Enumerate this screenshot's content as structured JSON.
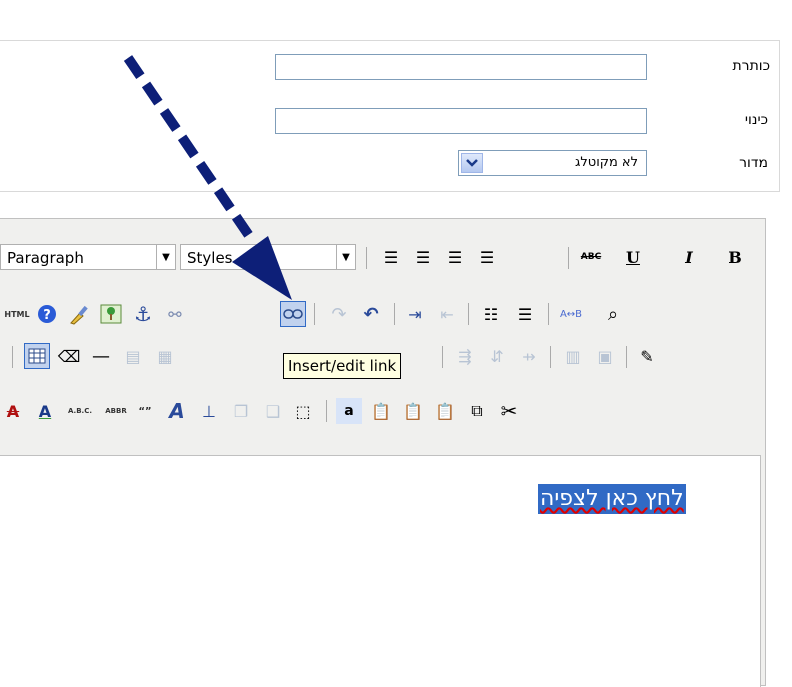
{
  "form": {
    "title_label": "כותרת",
    "title_value": "",
    "alias_label": "כינוי",
    "alias_value": "",
    "category_label": "מדור",
    "category_value": "לא מקוטלג"
  },
  "editor": {
    "format_select": "Paragraph",
    "styles_select": "Styles",
    "tooltip": "Insert/edit link",
    "content_text": "לחץ כאן לצפיה",
    "toolbar_text": {
      "bold": "B",
      "italic": "I",
      "underline": "U",
      "strike": "ABC",
      "html": "HTML",
      "abbr_abc": "A.B.C.",
      "abbr": "ABBR",
      "quote": "“”",
      "char_a": "a"
    }
  },
  "colors": {
    "selection": "#316ac5",
    "arrow": "#0d1f78",
    "tooltip_bg": "#ffffe1"
  }
}
